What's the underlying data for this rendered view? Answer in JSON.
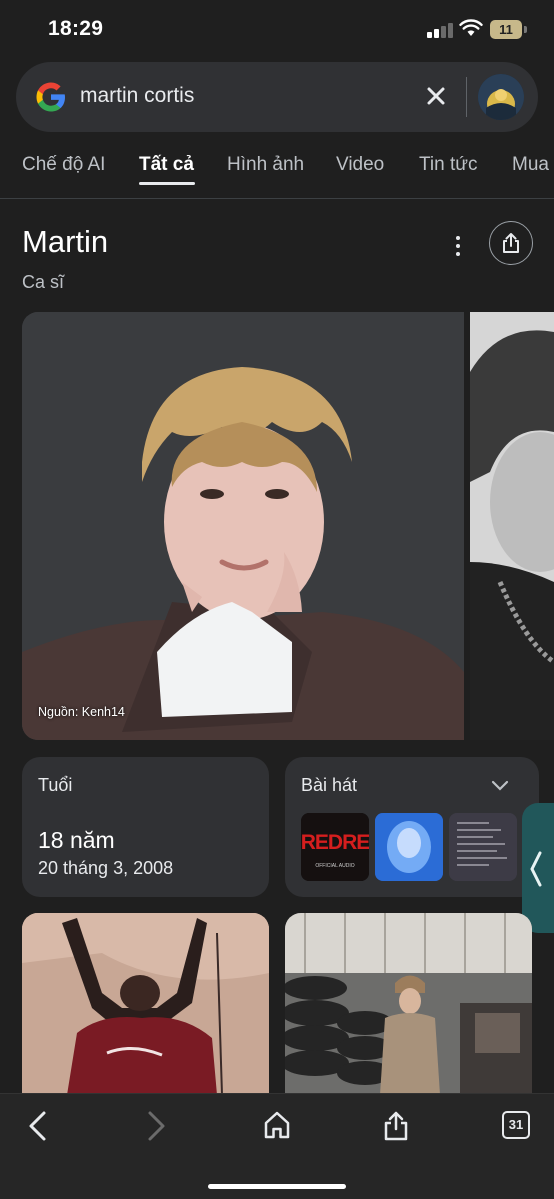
{
  "status": {
    "time": "18:29",
    "battery": "11"
  },
  "search": {
    "query": "martin cortis"
  },
  "tabs": [
    "Chế độ AI",
    "Tất cả",
    "Hình ảnh",
    "Video",
    "Tin tức",
    "Mua"
  ],
  "knowledge_panel": {
    "title": "Martin",
    "subtitle": "Ca sĩ",
    "image_credit": "Nguồn: Kenh14",
    "age_card": {
      "label": "Tuổi",
      "value": "18 năm",
      "birthdate": "20 tháng 3, 2008"
    },
    "songs_card": {
      "label": "Bài hát",
      "thumb1_text": "REDRE",
      "thumb1_caption": "OFFICIAL AUDIO"
    }
  },
  "bottom_nav": {
    "tab_count": "31"
  },
  "colors": {
    "background": "#1f1f1f",
    "search_bg": "#303134",
    "card_bg": "#303134",
    "side_handle": "#21575a"
  },
  "icons": [
    "google-logo",
    "close-icon",
    "more-vert-icon",
    "share-icon",
    "chevron-down-icon",
    "back-icon",
    "forward-icon",
    "home-icon",
    "tabs-icon"
  ]
}
